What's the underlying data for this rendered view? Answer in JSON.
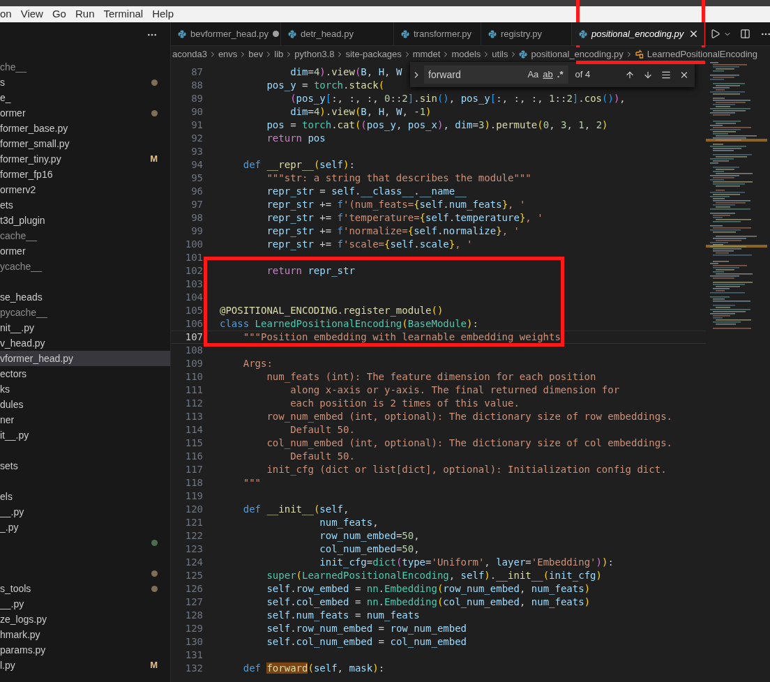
{
  "menu_bar": {
    "items": [
      "on",
      "View",
      "Go",
      "Run",
      "Terminal",
      "Help"
    ]
  },
  "sidebar": {
    "items": [
      {
        "kind": "entry",
        "name": "che__",
        "dimmed": true,
        "selected": false
      },
      {
        "kind": "entry",
        "name": "s",
        "dimmed": false,
        "color": "#7d6e55",
        "selected": false
      },
      {
        "kind": "entry",
        "name": "e_",
        "dimmed": false,
        "selected": false
      },
      {
        "kind": "entry",
        "name": "ormer",
        "dimmed": false,
        "color": "#7d6e55",
        "selected": false
      },
      {
        "kind": "entry",
        "name": "former_base.py",
        "dimmed": false,
        "selected": false
      },
      {
        "kind": "entry",
        "name": "former_small.py",
        "dimmed": false,
        "selected": false
      },
      {
        "kind": "entry",
        "name": "former_tiny.py",
        "dimmed": false,
        "git_status": "M",
        "selected": false
      },
      {
        "kind": "entry",
        "name": "former_fp16",
        "dimmed": false,
        "selected": false
      },
      {
        "kind": "entry",
        "name": "ormerv2",
        "dimmed": false,
        "selected": false
      },
      {
        "kind": "entry",
        "name": "ets",
        "dimmed": false,
        "selected": false
      },
      {
        "kind": "entry",
        "name": "t3d_plugin",
        "dimmed": false,
        "selected": false
      },
      {
        "kind": "entry",
        "name": "cache__",
        "dimmed": true,
        "selected": false
      },
      {
        "kind": "entry",
        "name": "ormer",
        "dimmed": false,
        "selected": false
      },
      {
        "kind": "entry",
        "name": "ycache__",
        "dimmed": true,
        "selected": false
      },
      {
        "kind": "spacer"
      },
      {
        "kind": "entry",
        "name": "se_heads",
        "dimmed": false,
        "selected": false
      },
      {
        "kind": "entry",
        "name": "pycache__",
        "dimmed": true,
        "selected": false
      },
      {
        "kind": "entry",
        "name": "nit__.py",
        "dimmed": false,
        "selected": false
      },
      {
        "kind": "entry",
        "name": "v_head.py",
        "dimmed": false,
        "selected": false
      },
      {
        "kind": "entry",
        "name": "vformer_head.py",
        "dimmed": false,
        "selected": true
      },
      {
        "kind": "entry",
        "name": "ectors",
        "dimmed": false,
        "selected": false
      },
      {
        "kind": "entry",
        "name": "ks",
        "dimmed": false,
        "selected": false
      },
      {
        "kind": "entry",
        "name": "dules",
        "dimmed": false,
        "selected": false
      },
      {
        "kind": "entry",
        "name": "ner",
        "dimmed": false,
        "selected": false
      },
      {
        "kind": "entry",
        "name": "it__.py",
        "dimmed": false,
        "selected": false
      },
      {
        "kind": "spacer"
      },
      {
        "kind": "entry",
        "name": "sets",
        "dimmed": false,
        "selected": false
      },
      {
        "kind": "spacer"
      },
      {
        "kind": "entry",
        "name": "els",
        "dimmed": false,
        "selected": false
      },
      {
        "kind": "entry",
        "name": "__.py",
        "dimmed": false,
        "selected": false
      },
      {
        "kind": "entry",
        "name": "_.py",
        "dimmed": false,
        "selected": false
      },
      {
        "kind": "entry",
        "color": "#4b6e50",
        "selected": false
      },
      {
        "kind": "spacer"
      },
      {
        "kind": "entry",
        "color": "#7d6e55",
        "selected": false
      },
      {
        "kind": "entry",
        "name": "s_tools",
        "dimmed": false,
        "color": "#7d6e55",
        "selected": false
      },
      {
        "kind": "entry",
        "name": "__.py",
        "dimmed": false,
        "selected": false
      },
      {
        "kind": "entry",
        "name": "ze_logs.py",
        "dimmed": false,
        "selected": false
      },
      {
        "kind": "entry",
        "name": "hmark.py",
        "dimmed": false,
        "selected": false
      },
      {
        "kind": "entry",
        "name": "params.py",
        "dimmed": false,
        "selected": false
      },
      {
        "kind": "entry",
        "name": "l.py",
        "dimmed": false,
        "git_status": "M",
        "selected": false
      }
    ]
  },
  "tabs": [
    {
      "label": "bevformer_head.py",
      "dirty": true,
      "selected": false
    },
    {
      "label": "detr_head.py",
      "dirty": false,
      "selected": false
    },
    {
      "label": "transformer.py",
      "dirty": false,
      "selected": false
    },
    {
      "label": "registry.py",
      "dirty": false,
      "selected": false
    },
    {
      "label": "positional_encoding.py",
      "dirty": false,
      "selected": true
    }
  ],
  "breadcrumbs": [
    {
      "label": "aconda3",
      "kind": "folder"
    },
    {
      "label": "envs",
      "kind": "folder"
    },
    {
      "label": "bev",
      "kind": "folder"
    },
    {
      "label": "lib",
      "kind": "folder"
    },
    {
      "label": "python3.8",
      "kind": "folder"
    },
    {
      "label": "site-packages",
      "kind": "folder"
    },
    {
      "label": "mmdet",
      "kind": "folder"
    },
    {
      "label": "models",
      "kind": "folder"
    },
    {
      "label": "utils",
      "kind": "folder"
    },
    {
      "label": "positional_encoding.py",
      "kind": "file"
    },
    {
      "label": "LearnedPositionalEncoding",
      "kind": "class"
    }
  ],
  "find_widget": {
    "query": "forward",
    "options": [
      {
        "kind": "case",
        "label": "Aa"
      },
      {
        "kind": "word",
        "label": "ab"
      },
      {
        "kind": "regex",
        "label": ".*"
      }
    ],
    "count": "of 4"
  },
  "editor": {
    "lines": [
      {
        "number": "87",
        "current": false,
        "tokens": [
          {
            "text": "            dim",
            "kind": "var"
          },
          {
            "text": "=",
            "kind": "punct"
          },
          {
            "text": "4",
            "kind": "number"
          },
          {
            "text": ")",
            "kind": "bracket2"
          },
          {
            "text": ".",
            "kind": "punct"
          },
          {
            "text": "view",
            "kind": "function"
          },
          {
            "text": "(",
            "kind": "bracket2"
          },
          {
            "text": "B",
            "kind": "var"
          },
          {
            "text": ", ",
            "kind": "punct"
          },
          {
            "text": "H",
            "kind": "var"
          },
          {
            "text": ", ",
            "kind": "punct"
          },
          {
            "text": "W",
            "kind": "var"
          }
        ]
      },
      {
        "number": "88",
        "current": false,
        "tokens": [
          {
            "text": "        pos_y",
            "kind": "var"
          },
          {
            "text": " = ",
            "kind": "punct"
          },
          {
            "text": "torch",
            "kind": "type"
          },
          {
            "text": ".",
            "kind": "punct"
          },
          {
            "text": "stack",
            "kind": "function"
          },
          {
            "text": "(",
            "kind": "bracket1"
          }
        ]
      },
      {
        "number": "89",
        "current": false,
        "tokens": [
          {
            "text": "            (",
            "kind": "bracket2"
          },
          {
            "text": "pos_y",
            "kind": "var"
          },
          {
            "text": "[",
            "kind": "bracket3"
          },
          {
            "text": ":, :, :, ",
            "kind": "punct"
          },
          {
            "text": "0",
            "kind": "number"
          },
          {
            "text": "::",
            "kind": "punct"
          },
          {
            "text": "2",
            "kind": "number"
          },
          {
            "text": "]",
            "kind": "bracket3"
          },
          {
            "text": ".",
            "kind": "punct"
          },
          {
            "text": "sin",
            "kind": "function"
          },
          {
            "text": "()",
            "kind": "bracket3"
          },
          {
            "text": ", ",
            "kind": "punct"
          },
          {
            "text": "pos_y",
            "kind": "var"
          },
          {
            "text": "[",
            "kind": "bracket3"
          },
          {
            "text": ":, :, :, ",
            "kind": "punct"
          },
          {
            "text": "1",
            "kind": "number"
          },
          {
            "text": "::",
            "kind": "punct"
          },
          {
            "text": "2",
            "kind": "number"
          },
          {
            "text": "]",
            "kind": "bracket3"
          },
          {
            "text": ".",
            "kind": "punct"
          },
          {
            "text": "cos",
            "kind": "function"
          },
          {
            "text": "()",
            "kind": "bracket3"
          },
          {
            "text": ")",
            "kind": "bracket2"
          },
          {
            "text": ",",
            "kind": "punct"
          }
        ]
      },
      {
        "number": "90",
        "current": false,
        "tokens": [
          {
            "text": "            dim",
            "kind": "var"
          },
          {
            "text": "=",
            "kind": "punct"
          },
          {
            "text": "4",
            "kind": "number"
          },
          {
            "text": ")",
            "kind": "bracket1"
          },
          {
            "text": ".",
            "kind": "punct"
          },
          {
            "text": "view",
            "kind": "function"
          },
          {
            "text": "(",
            "kind": "bracket1"
          },
          {
            "text": "B",
            "kind": "var"
          },
          {
            "text": ", ",
            "kind": "punct"
          },
          {
            "text": "H",
            "kind": "var"
          },
          {
            "text": ", ",
            "kind": "punct"
          },
          {
            "text": "W",
            "kind": "var"
          },
          {
            "text": ", -",
            "kind": "punct"
          },
          {
            "text": "1",
            "kind": "number"
          },
          {
            "text": ")",
            "kind": "bracket1"
          }
        ]
      },
      {
        "number": "91",
        "current": false,
        "tokens": [
          {
            "text": "        pos",
            "kind": "var"
          },
          {
            "text": " = ",
            "kind": "punct"
          },
          {
            "text": "torch",
            "kind": "type"
          },
          {
            "text": ".",
            "kind": "punct"
          },
          {
            "text": "cat",
            "kind": "function"
          },
          {
            "text": "(",
            "kind": "bracket1"
          },
          {
            "text": "(",
            "kind": "bracket2"
          },
          {
            "text": "pos_y",
            "kind": "var"
          },
          {
            "text": ", ",
            "kind": "punct"
          },
          {
            "text": "pos_x",
            "kind": "var"
          },
          {
            "text": ")",
            "kind": "bracket2"
          },
          {
            "text": ", ",
            "kind": "punct"
          },
          {
            "text": "dim",
            "kind": "var"
          },
          {
            "text": "=",
            "kind": "punct"
          },
          {
            "text": "3",
            "kind": "number"
          },
          {
            "text": ")",
            "kind": "bracket1"
          },
          {
            "text": ".",
            "kind": "punct"
          },
          {
            "text": "permute",
            "kind": "function"
          },
          {
            "text": "(",
            "kind": "bracket1"
          },
          {
            "text": "0",
            "kind": "number"
          },
          {
            "text": ", ",
            "kind": "punct"
          },
          {
            "text": "3",
            "kind": "number"
          },
          {
            "text": ", ",
            "kind": "punct"
          },
          {
            "text": "1",
            "kind": "number"
          },
          {
            "text": ", ",
            "kind": "punct"
          },
          {
            "text": "2",
            "kind": "number"
          },
          {
            "text": ")",
            "kind": "bracket1"
          }
        ]
      },
      {
        "number": "92",
        "current": false,
        "tokens": [
          {
            "text": "        return",
            "kind": "control"
          },
          {
            "text": " pos",
            "kind": "var"
          }
        ]
      },
      {
        "number": "93",
        "current": false
      },
      {
        "number": "94",
        "current": false,
        "tokens": [
          {
            "text": "    def",
            "kind": "keyword"
          },
          {
            "text": " __repr__",
            "kind": "function"
          },
          {
            "text": "(",
            "kind": "bracket1"
          },
          {
            "text": "self",
            "kind": "var"
          },
          {
            "text": ")",
            "kind": "bracket1"
          },
          {
            "text": ":",
            "kind": "punct"
          }
        ]
      },
      {
        "number": "95",
        "current": false,
        "tokens": [
          {
            "text": "        \"\"\"str: a string that describes the module\"\"\"",
            "kind": "string"
          }
        ]
      },
      {
        "number": "96",
        "current": false,
        "tokens": [
          {
            "text": "        repr_str",
            "kind": "var"
          },
          {
            "text": " = ",
            "kind": "punct"
          },
          {
            "text": "self",
            "kind": "var"
          },
          {
            "text": ".",
            "kind": "punct"
          },
          {
            "text": "__class__",
            "kind": "var"
          },
          {
            "text": ".",
            "kind": "punct"
          },
          {
            "text": "__name__",
            "kind": "var"
          }
        ]
      },
      {
        "number": "97",
        "current": false,
        "tokens": [
          {
            "text": "        repr_str",
            "kind": "var"
          },
          {
            "text": " += ",
            "kind": "punct"
          },
          {
            "text": "f",
            "kind": "keyword"
          },
          {
            "text": "'(num_feats=",
            "kind": "string"
          },
          {
            "text": "{",
            "kind": "bracket1"
          },
          {
            "text": "self",
            "kind": "var"
          },
          {
            "text": ".",
            "kind": "punct"
          },
          {
            "text": "num_feats",
            "kind": "var"
          },
          {
            "text": "}",
            "kind": "bracket1"
          },
          {
            "text": ", '",
            "kind": "string"
          }
        ]
      },
      {
        "number": "98",
        "current": false,
        "tokens": [
          {
            "text": "        repr_str",
            "kind": "var"
          },
          {
            "text": " += ",
            "kind": "punct"
          },
          {
            "text": "f",
            "kind": "keyword"
          },
          {
            "text": "'temperature=",
            "kind": "string"
          },
          {
            "text": "{",
            "kind": "bracket1"
          },
          {
            "text": "self",
            "kind": "var"
          },
          {
            "text": ".",
            "kind": "punct"
          },
          {
            "text": "temperature",
            "kind": "var"
          },
          {
            "text": "}",
            "kind": "bracket1"
          },
          {
            "text": ", '",
            "kind": "string"
          }
        ]
      },
      {
        "number": "99",
        "current": false,
        "tokens": [
          {
            "text": "        repr_str",
            "kind": "var"
          },
          {
            "text": " += ",
            "kind": "punct"
          },
          {
            "text": "f",
            "kind": "keyword"
          },
          {
            "text": "'normalize=",
            "kind": "string"
          },
          {
            "text": "{",
            "kind": "bracket1"
          },
          {
            "text": "self",
            "kind": "var"
          },
          {
            "text": ".",
            "kind": "punct"
          },
          {
            "text": "normalize",
            "kind": "var"
          },
          {
            "text": "}",
            "kind": "bracket1"
          },
          {
            "text": ", '",
            "kind": "string"
          }
        ]
      },
      {
        "number": "100",
        "current": false,
        "tokens": [
          {
            "text": "        repr_str",
            "kind": "var"
          },
          {
            "text": " += ",
            "kind": "punct"
          },
          {
            "text": "f",
            "kind": "keyword"
          },
          {
            "text": "'scale=",
            "kind": "string"
          },
          {
            "text": "{",
            "kind": "bracket1"
          },
          {
            "text": "self",
            "kind": "var"
          },
          {
            "text": ".",
            "kind": "punct"
          },
          {
            "text": "scale",
            "kind": "var"
          },
          {
            "text": "}",
            "kind": "bracket1"
          },
          {
            "text": ", '",
            "kind": "string"
          }
        ]
      },
      {
        "number": "101",
        "current": false
      },
      {
        "number": "102",
        "current": false,
        "tokens": [
          {
            "text": "        return",
            "kind": "control"
          },
          {
            "text": " repr_str",
            "kind": "var"
          }
        ]
      },
      {
        "number": "103",
        "current": false
      },
      {
        "number": "104",
        "current": false
      },
      {
        "number": "105",
        "current": false,
        "tokens": [
          {
            "text": "@POSITIONAL_ENCODING",
            "kind": "function"
          },
          {
            "text": ".",
            "kind": "punct"
          },
          {
            "text": "register_module",
            "kind": "function"
          },
          {
            "text": "()",
            "kind": "bracket1"
          }
        ]
      },
      {
        "number": "106",
        "current": false,
        "tokens": [
          {
            "text": "class",
            "kind": "keyword"
          },
          {
            "text": " LearnedPositionalEncoding",
            "kind": "type"
          },
          {
            "text": "(",
            "kind": "bracket1"
          },
          {
            "text": "BaseModule",
            "kind": "type"
          },
          {
            "text": ")",
            "kind": "bracket1"
          },
          {
            "text": ":",
            "kind": "punct"
          }
        ]
      },
      {
        "number": "107",
        "current": true,
        "tokens": [
          {
            "text": "    \"\"\"Position embedding with learnable embedding weights",
            "kind": "string"
          }
        ]
      },
      {
        "number": "108",
        "current": false
      },
      {
        "number": "109",
        "current": false,
        "tokens": [
          {
            "text": "    Args:",
            "kind": "string"
          }
        ]
      },
      {
        "number": "110",
        "current": false,
        "tokens": [
          {
            "text": "        num_feats (int): The feature dimension for each position",
            "kind": "string"
          }
        ]
      },
      {
        "number": "111",
        "current": false,
        "tokens": [
          {
            "text": "            along x-axis or y-axis. The final returned dimension for",
            "kind": "string"
          }
        ]
      },
      {
        "number": "112",
        "current": false,
        "tokens": [
          {
            "text": "            each position is 2 times of this value.",
            "kind": "string"
          }
        ]
      },
      {
        "number": "113",
        "current": false,
        "tokens": [
          {
            "text": "        row_num_embed (int, optional): The dictionary size of row embeddings.",
            "kind": "string"
          }
        ]
      },
      {
        "number": "114",
        "current": false,
        "tokens": [
          {
            "text": "            Default 50.",
            "kind": "string"
          }
        ]
      },
      {
        "number": "115",
        "current": false,
        "tokens": [
          {
            "text": "        col_num_embed (int, optional): The dictionary size of col embeddings.",
            "kind": "string"
          }
        ]
      },
      {
        "number": "116",
        "current": false,
        "tokens": [
          {
            "text": "            Default 50.",
            "kind": "string"
          }
        ]
      },
      {
        "number": "117",
        "current": false,
        "tokens": [
          {
            "text": "        init_cfg (dict or list[dict], optional): Initialization config dict.",
            "kind": "string"
          }
        ]
      },
      {
        "number": "118",
        "current": false,
        "tokens": [
          {
            "text": "    \"\"\"",
            "kind": "string"
          }
        ]
      },
      {
        "number": "119",
        "current": false
      },
      {
        "number": "120",
        "current": false,
        "tokens": [
          {
            "text": "    def",
            "kind": "keyword"
          },
          {
            "text": " __init__",
            "kind": "function"
          },
          {
            "text": "(",
            "kind": "bracket1"
          },
          {
            "text": "self",
            "kind": "var"
          },
          {
            "text": ",",
            "kind": "punct"
          }
        ]
      },
      {
        "number": "121",
        "current": false,
        "tokens": [
          {
            "text": "                 num_feats",
            "kind": "var"
          },
          {
            "text": ",",
            "kind": "punct"
          }
        ]
      },
      {
        "number": "122",
        "current": false,
        "tokens": [
          {
            "text": "                 row_num_embed",
            "kind": "var"
          },
          {
            "text": "=",
            "kind": "punct"
          },
          {
            "text": "50",
            "kind": "number"
          },
          {
            "text": ",",
            "kind": "punct"
          }
        ]
      },
      {
        "number": "123",
        "current": false,
        "tokens": [
          {
            "text": "                 col_num_embed",
            "kind": "var"
          },
          {
            "text": "=",
            "kind": "punct"
          },
          {
            "text": "50",
            "kind": "number"
          },
          {
            "text": ",",
            "kind": "punct"
          }
        ]
      },
      {
        "number": "124",
        "current": false,
        "tokens": [
          {
            "text": "                 init_cfg",
            "kind": "var"
          },
          {
            "text": "=",
            "kind": "punct"
          },
          {
            "text": "dict",
            "kind": "type"
          },
          {
            "text": "(",
            "kind": "bracket2"
          },
          {
            "text": "type",
            "kind": "var"
          },
          {
            "text": "=",
            "kind": "punct"
          },
          {
            "text": "'Uniform'",
            "kind": "string"
          },
          {
            "text": ", ",
            "kind": "punct"
          },
          {
            "text": "layer",
            "kind": "var"
          },
          {
            "text": "=",
            "kind": "punct"
          },
          {
            "text": "'Embedding'",
            "kind": "string"
          },
          {
            "text": ")",
            "kind": "bracket2"
          },
          {
            "text": ")",
            "kind": "bracket1"
          },
          {
            "text": ":",
            "kind": "punct"
          }
        ]
      },
      {
        "number": "125",
        "current": false,
        "tokens": [
          {
            "text": "        super",
            "kind": "type"
          },
          {
            "text": "(",
            "kind": "bracket1"
          },
          {
            "text": "LearnedPositionalEncoding",
            "kind": "type"
          },
          {
            "text": ", ",
            "kind": "punct"
          },
          {
            "text": "self",
            "kind": "var"
          },
          {
            "text": ")",
            "kind": "bracket1"
          },
          {
            "text": ".",
            "kind": "punct"
          },
          {
            "text": "__init__",
            "kind": "function"
          },
          {
            "text": "(",
            "kind": "bracket1"
          },
          {
            "text": "init_cfg",
            "kind": "var"
          },
          {
            "text": ")",
            "kind": "bracket1"
          }
        ]
      },
      {
        "number": "126",
        "current": false,
        "tokens": [
          {
            "text": "        self",
            "kind": "var"
          },
          {
            "text": ".",
            "kind": "punct"
          },
          {
            "text": "row_embed",
            "kind": "var"
          },
          {
            "text": " = ",
            "kind": "punct"
          },
          {
            "text": "nn",
            "kind": "type"
          },
          {
            "text": ".",
            "kind": "punct"
          },
          {
            "text": "Embedding",
            "kind": "type"
          },
          {
            "text": "(",
            "kind": "bracket1"
          },
          {
            "text": "row_num_embed",
            "kind": "var"
          },
          {
            "text": ", ",
            "kind": "punct"
          },
          {
            "text": "num_feats",
            "kind": "var"
          },
          {
            "text": ")",
            "kind": "bracket1"
          }
        ]
      },
      {
        "number": "127",
        "current": false,
        "tokens": [
          {
            "text": "        self",
            "kind": "var"
          },
          {
            "text": ".",
            "kind": "punct"
          },
          {
            "text": "col_embed",
            "kind": "var"
          },
          {
            "text": " = ",
            "kind": "punct"
          },
          {
            "text": "nn",
            "kind": "type"
          },
          {
            "text": ".",
            "kind": "punct"
          },
          {
            "text": "Embedding",
            "kind": "type"
          },
          {
            "text": "(",
            "kind": "bracket1"
          },
          {
            "text": "col_num_embed",
            "kind": "var"
          },
          {
            "text": ", ",
            "kind": "punct"
          },
          {
            "text": "num_feats",
            "kind": "var"
          },
          {
            "text": ")",
            "kind": "bracket1"
          }
        ]
      },
      {
        "number": "128",
        "current": false,
        "tokens": [
          {
            "text": "        self",
            "kind": "var"
          },
          {
            "text": ".",
            "kind": "punct"
          },
          {
            "text": "num_feats",
            "kind": "var"
          },
          {
            "text": " = ",
            "kind": "punct"
          },
          {
            "text": "num_feats",
            "kind": "var"
          }
        ]
      },
      {
        "number": "129",
        "current": false,
        "tokens": [
          {
            "text": "        self",
            "kind": "var"
          },
          {
            "text": ".",
            "kind": "punct"
          },
          {
            "text": "row_num_embed",
            "kind": "var"
          },
          {
            "text": " = ",
            "kind": "punct"
          },
          {
            "text": "row_num_embed",
            "kind": "var"
          }
        ]
      },
      {
        "number": "130",
        "current": false,
        "tokens": [
          {
            "text": "        self",
            "kind": "var"
          },
          {
            "text": ".",
            "kind": "punct"
          },
          {
            "text": "col_num_embed",
            "kind": "var"
          },
          {
            "text": " = ",
            "kind": "punct"
          },
          {
            "text": "col_num_embed",
            "kind": "var"
          }
        ]
      },
      {
        "number": "131",
        "current": false
      },
      {
        "number": "132",
        "current": false,
        "tokens": [
          {
            "text": "    def ",
            "kind": "keyword"
          },
          {
            "text": "forward",
            "kind": "match"
          },
          {
            "text": "(",
            "kind": "bracket1"
          },
          {
            "text": "self",
            "kind": "var"
          },
          {
            "text": ", ",
            "kind": "punct"
          },
          {
            "text": "mask",
            "kind": "var"
          },
          {
            "text": ")",
            "kind": "bracket1"
          },
          {
            "text": ":",
            "kind": "punct"
          }
        ]
      }
    ]
  }
}
